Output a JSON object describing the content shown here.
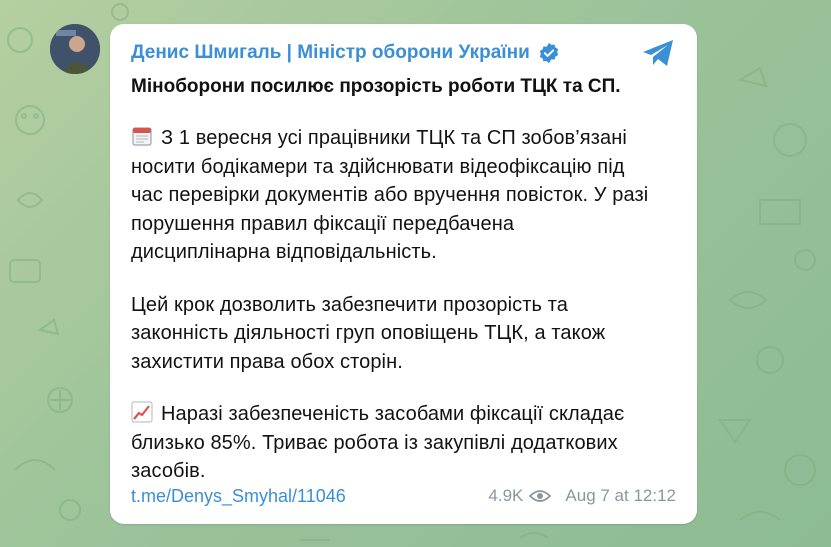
{
  "post": {
    "channel_name": "Денис Шмигаль | Міністр оборони України",
    "title": "Міноборони посилює прозорість роботи ТЦК та СП.",
    "paragraph1_lines": [
      "З 1 вересня усі працівники ТЦК та СП зобов’язані",
      "носити бодікамери та здійснювати відеофіксацію під",
      "час перевірки документів або вручення повісток. У разі",
      "порушення правил фіксації передбачена",
      "дисциплінарна відповідальність."
    ],
    "paragraph2_lines": [
      "Цей крок дозволить забезпечити прозорість та",
      "законність діяльності груп оповіщень ТЦК, а також",
      "захистити права обох сторін."
    ],
    "paragraph3_lines": [
      "Наразі забезпеченість засобами фіксації складає",
      "близько 85%. Триває робота із закупівлі додаткових",
      "засобів."
    ],
    "link": "t.me/Denys_Smyhal/11046",
    "views": "4.9K",
    "date": "Aug 7 at 12:12"
  },
  "icons": {
    "paragraph1_emoji": "calendar-icon",
    "paragraph3_emoji": "chart-increasing-icon",
    "verified": "verified-badge-icon",
    "share": "telegram-share-icon",
    "views": "eye-icon"
  },
  "colors": {
    "accent": "#3a8fd6",
    "text": "#121212",
    "meta": "#8d969f",
    "background": "#9cc39a"
  }
}
